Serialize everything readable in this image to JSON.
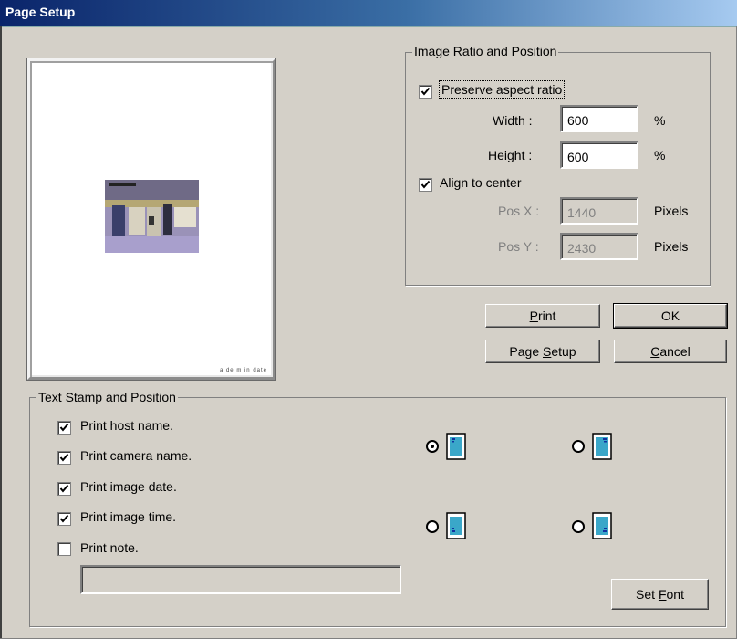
{
  "window": {
    "title": "Page Setup"
  },
  "image_ratio": {
    "title": "Image Ratio and Position",
    "preserve_aspect": {
      "label": "Preserve aspect ratio",
      "checked": true
    },
    "width": {
      "label": "Width :",
      "value": "600",
      "unit": "%"
    },
    "height": {
      "label": "Height :",
      "value": "600",
      "unit": "%"
    },
    "align_center": {
      "label": "Align to center",
      "checked": true
    },
    "pos_x": {
      "label": "Pos X :",
      "value": "1440",
      "unit": "Pixels"
    },
    "pos_y": {
      "label": "Pos Y :",
      "value": "2430",
      "unit": "Pixels"
    }
  },
  "buttons": {
    "print": {
      "pre": "",
      "key": "P",
      "post": "rint"
    },
    "ok": {
      "label": "OK"
    },
    "page_setup": {
      "pre": "Page ",
      "key": "S",
      "post": "etup"
    },
    "cancel": {
      "pre": "",
      "key": "C",
      "post": "ancel"
    },
    "set_font": {
      "pre": "Set ",
      "key": "F",
      "post": "ont"
    }
  },
  "text_stamp": {
    "title": "Text Stamp and Position",
    "options": [
      {
        "label": "Print host name.",
        "checked": true
      },
      {
        "label": "Print camera name.",
        "checked": true
      },
      {
        "label": "Print image date.",
        "checked": true
      },
      {
        "label": "Print image time.",
        "checked": true
      },
      {
        "label": "Print note.",
        "checked": false
      }
    ],
    "note_value": "",
    "position_selected": "top-left"
  },
  "preview": {
    "footer_text": "a de  m   in date"
  }
}
